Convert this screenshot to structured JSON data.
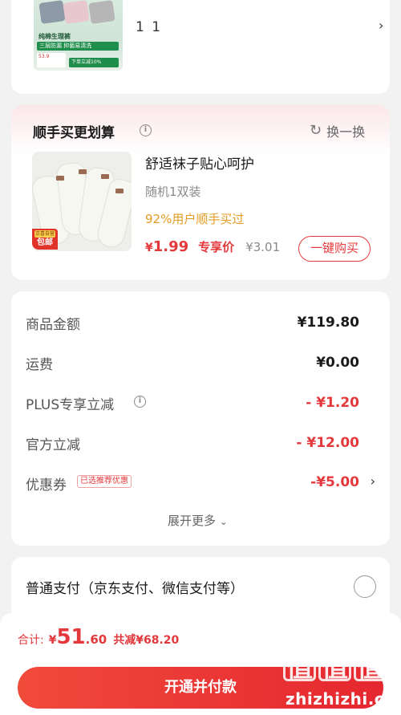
{
  "top_item": {
    "thumb_title": "纯棉生理裤",
    "thumb_banner": "三层防漏 抑菌易清洗",
    "thumb_price": "53.9",
    "thumb_tag": "下单立减10%",
    "quantity": "1 1"
  },
  "recommend": {
    "title": "顺手买更划算",
    "swap_label": "换一换",
    "product_name": "舒适袜子贴心呵护",
    "spec": "随机1双装",
    "ratio": "92%用户顺手买过",
    "price_symbol": "¥",
    "price": "1.99",
    "price_tag": "专享价",
    "original_price": "¥3.01",
    "buy_label": "一键购买",
    "badge_small": "京喜自营",
    "badge_big": "包邮"
  },
  "summary": {
    "rows": [
      {
        "label": "商品金额",
        "value": "¥119.80"
      },
      {
        "label": "运费",
        "value": "¥0.00"
      },
      {
        "label": "PLUS专享立减",
        "value": "- ¥1.20"
      },
      {
        "label": "官方立减",
        "value": "- ¥12.00"
      },
      {
        "label": "优惠券",
        "value": "-¥5.00"
      }
    ],
    "coupon_tag": "已选推荐优惠",
    "expand_label": "展开更多"
  },
  "payment": {
    "method_label": "普通支付（京东支付、微信支付等）"
  },
  "bottom": {
    "total_label": "合计:",
    "total_symbol": "¥",
    "total_integer": "51",
    "total_decimal": ".60",
    "saved_label": "共减¥68.20",
    "pay_button": "开通并付款"
  },
  "watermark": {
    "logo": [
      "值",
      "值",
      "值"
    ],
    "site": "zhizhizhi.com"
  },
  "colors": {
    "accent_red": "#e4393c",
    "ratio_orange": "#e39c23",
    "page_bg": "#f2f2f2"
  },
  "icons": [
    "info-icon",
    "refresh-icon",
    "chevron-right-icon",
    "chevron-down-icon",
    "radio-icon"
  ]
}
